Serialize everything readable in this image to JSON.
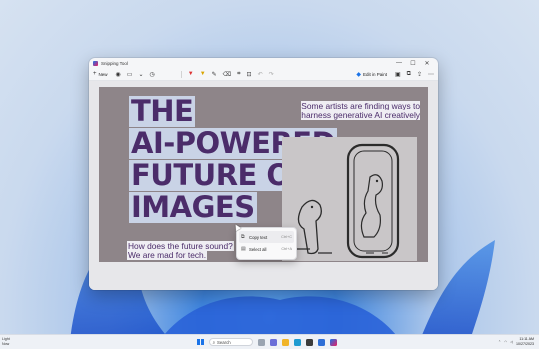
{
  "window": {
    "title": "Snipping Tool",
    "controls": [
      "—",
      "☐",
      "✕"
    ]
  },
  "toolbar": {
    "new_label": "New",
    "edit_in_paint_label": "Edit in Paint",
    "icons": [
      "camera-icon",
      "video-icon",
      "timer-icon",
      "pen-red-icon",
      "pen-yellow-icon",
      "highlighter-icon",
      "eraser-icon",
      "crop-icon",
      "text-actions-icon",
      "undo-icon",
      "redo-icon",
      "save-icon",
      "copy-icon",
      "share-icon",
      "more-icon"
    ]
  },
  "image": {
    "headline_lines": [
      "THE",
      "AI-POWERED",
      "FUTURE OF",
      "IMAGES"
    ],
    "side_caption": "Some artists are finding ways to harness generative AI creatively",
    "bottom_caption_lines": [
      "How does the future sound?",
      "We are mad for tech."
    ]
  },
  "context_menu": {
    "items": [
      {
        "label": "Copy text",
        "shortcut": "Ctrl+C"
      },
      {
        "label": "Select all",
        "shortcut": "Ctrl+A"
      }
    ]
  },
  "taskbar": {
    "weather": [
      "Light",
      "Now"
    ],
    "search_placeholder": "Search",
    "time": "11:11 AM",
    "date": "10/27/2023"
  },
  "colors": {
    "headline_text": "#4b2c6a",
    "headline_bg": "#c9d3e6",
    "image_bg": "#8e8589",
    "accent": "#1a73e8"
  }
}
